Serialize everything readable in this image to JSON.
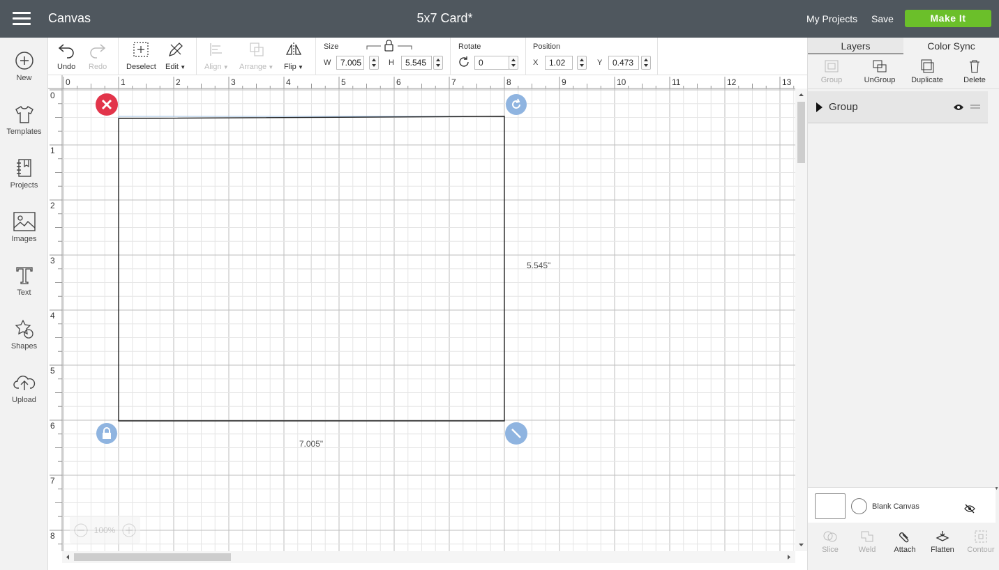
{
  "header": {
    "app_name": "Canvas",
    "title": "5x7 Card*",
    "my_projects": "My Projects",
    "save": "Save",
    "make_it": "Make It"
  },
  "sidebar": {
    "items": [
      {
        "label": "New",
        "icon": "plus-circle-icon"
      },
      {
        "label": "Templates",
        "icon": "tshirt-icon"
      },
      {
        "label": "Projects",
        "icon": "notebook-icon"
      },
      {
        "label": "Images",
        "icon": "image-icon"
      },
      {
        "label": "Text",
        "icon": "text-t-icon"
      },
      {
        "label": "Shapes",
        "icon": "shapes-icon"
      },
      {
        "label": "Upload",
        "icon": "cloud-upload-icon"
      }
    ]
  },
  "toolbar": {
    "undo": "Undo",
    "redo": "Redo",
    "deselect": "Deselect",
    "edit": "Edit",
    "align": "Align",
    "arrange": "Arrange",
    "flip": "Flip",
    "size_label": "Size",
    "w_label": "W",
    "width": "7.005",
    "h_label": "H",
    "height": "5.545",
    "rotate_label": "Rotate",
    "rotate": "0",
    "position_label": "Position",
    "x_label": "X",
    "x": "1.02",
    "y_label": "Y",
    "y": "0.473"
  },
  "canvas": {
    "ruler_top": [
      "0",
      "1",
      "2",
      "3",
      "4",
      "5",
      "6",
      "7",
      "8",
      "9",
      "10",
      "11",
      "12",
      "13"
    ],
    "ruler_left": [
      "0",
      "1",
      "2",
      "3",
      "4",
      "5",
      "6",
      "7",
      "8"
    ],
    "width_label": "7.005\"",
    "height_label": "5.545\"",
    "zoom": "100%"
  },
  "layers_panel": {
    "tabs": [
      "Layers",
      "Color Sync"
    ],
    "actions": [
      "Group",
      "UnGroup",
      "Duplicate",
      "Delete"
    ],
    "group_label": "Group",
    "blank_canvas": "Blank Canvas",
    "bottom_actions": [
      "Slice",
      "Weld",
      "Attach",
      "Flatten",
      "Contour"
    ]
  },
  "colors": {
    "topbar": "#4f575e",
    "make_it": "#6bbf2a",
    "delete_handle": "#e2344a",
    "handle": "#8fb4e0"
  }
}
